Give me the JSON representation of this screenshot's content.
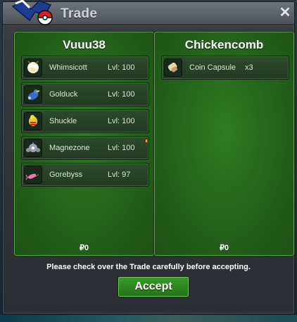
{
  "window": {
    "title": "Trade",
    "close_icon": "close-icon"
  },
  "left_panel": {
    "trader_name": "Vuuu38",
    "items": [
      {
        "name": "Whimsicott",
        "level": "Lvl: 100",
        "icon": "whimsicott-icon"
      },
      {
        "name": "Golduck",
        "level": "Lvl: 100",
        "icon": "golduck-icon"
      },
      {
        "name": "Shuckle",
        "level": "Lvl: 100",
        "icon": "shuckle-icon"
      },
      {
        "name": "Magnezone",
        "level": "Lvl: 100",
        "icon": "magnezone-icon"
      },
      {
        "name": "Gorebyss",
        "level": "Lvl: 97",
        "icon": "gorebyss-icon"
      }
    ],
    "money": "₽0"
  },
  "right_panel": {
    "trader_name": "Chickencomb",
    "items": [
      {
        "name": "Coin Capsule",
        "quantity": "x3",
        "icon": "coin-capsule-icon"
      }
    ],
    "money": "₽0"
  },
  "notice": "Please check over the Trade carefully before accepting.",
  "accept_label": "Accept",
  "colors": {
    "panel_green": "#23601a",
    "accept_green": "#2f8a22",
    "title_text": "#cfd3d6"
  }
}
